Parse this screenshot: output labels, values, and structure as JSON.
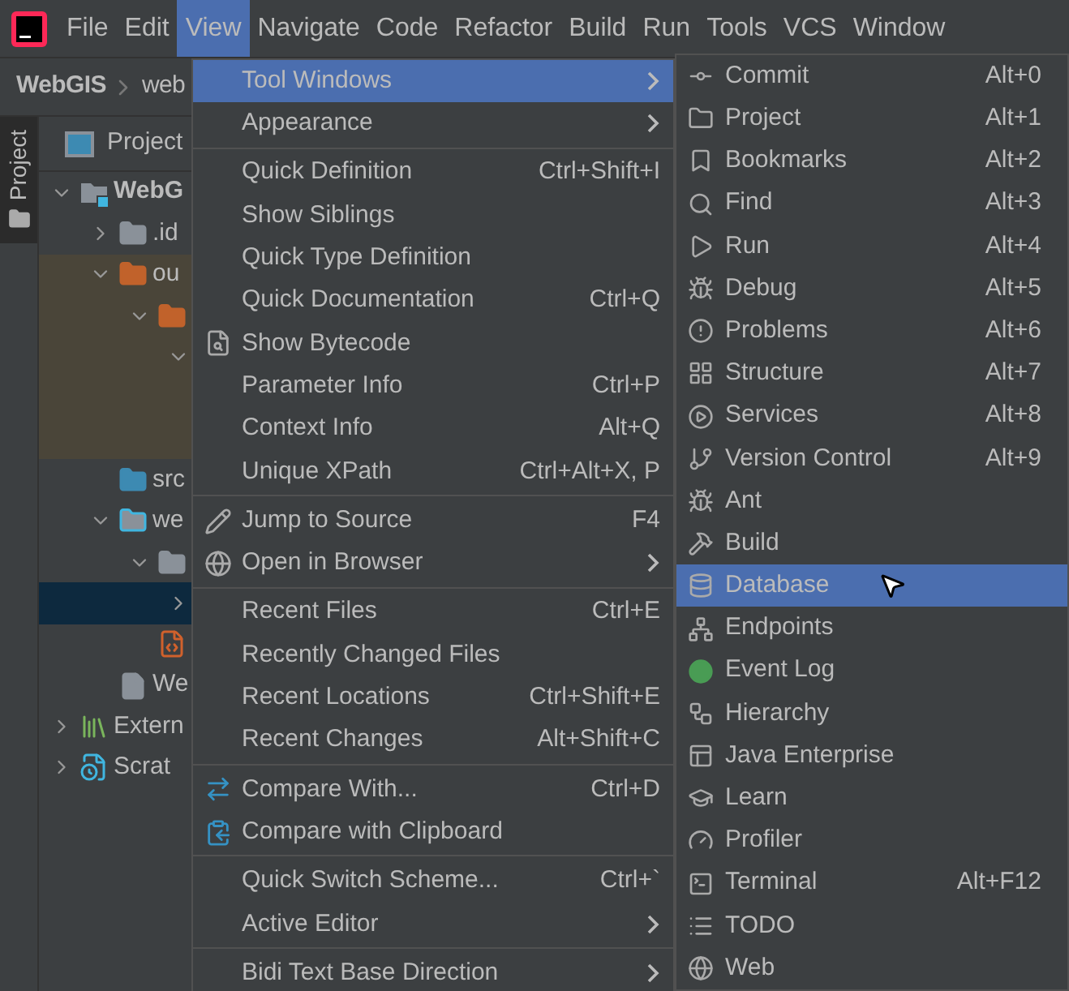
{
  "menubar": {
    "items": [
      {
        "label": "File",
        "selected": false
      },
      {
        "label": "Edit",
        "selected": false
      },
      {
        "label": "View",
        "selected": true
      },
      {
        "label": "Navigate",
        "selected": false
      },
      {
        "label": "Code",
        "selected": false
      },
      {
        "label": "Refactor",
        "selected": false
      },
      {
        "label": "Build",
        "selected": false
      },
      {
        "label": "Run",
        "selected": false
      },
      {
        "label": "Tools",
        "selected": false
      },
      {
        "label": "VCS",
        "selected": false
      },
      {
        "label": "Window",
        "selected": false
      }
    ]
  },
  "breadcrumb": [
    "WebGIS",
    "web"
  ],
  "side_tab": {
    "label": "Project",
    "selected": true
  },
  "project_panel": {
    "title": "Project",
    "tree": [
      {
        "kind": "module",
        "label": "WebG",
        "expanded": true,
        "selected": false,
        "children": [
          {
            "kind": "folder",
            "label": ".id",
            "expanded": false,
            "selected": false
          },
          {
            "kind": "excluded",
            "label": "ou",
            "expanded": true,
            "selected": false,
            "children": [
              {
                "kind": "excluded",
                "expanded": true,
                "selected": false,
                "children": [
                  {
                    "expanded": true,
                    "selected": false
                  }
                ]
              }
            ]
          },
          {
            "kind": "source",
            "label": "src",
            "selected": false
          },
          {
            "kind": "web",
            "label": "we",
            "expanded": true,
            "selected": false,
            "children": [
              {
                "kind": "folder",
                "expanded": true,
                "selected": false,
                "children": [
                  {
                    "expanded": false,
                    "selected": true
                  }
                ]
              },
              {
                "kind": "jsp",
                "selected": false
              }
            ]
          },
          {
            "kind": "file",
            "label": "We",
            "selected": false
          }
        ]
      },
      {
        "kind": "libraries",
        "label": "Extern",
        "expanded": false,
        "selected": false
      },
      {
        "kind": "scratches",
        "label": "Scrat",
        "expanded": false,
        "selected": false
      }
    ]
  },
  "view_menu": {
    "items": [
      {
        "kind": "item",
        "label": "Tool Windows",
        "submenu": true,
        "selected": true
      },
      {
        "kind": "item",
        "label": "Appearance",
        "submenu": true,
        "selected": false
      },
      {
        "kind": "separator"
      },
      {
        "kind": "item",
        "label": "Quick Definition",
        "shortcut": "Ctrl+Shift+I",
        "submenu": false,
        "selected": false
      },
      {
        "kind": "item",
        "label": "Show Siblings",
        "submenu": false,
        "selected": false
      },
      {
        "kind": "item",
        "label": "Quick Type Definition",
        "submenu": false,
        "selected": false
      },
      {
        "kind": "item",
        "label": "Quick Documentation",
        "shortcut": "Ctrl+Q",
        "submenu": false,
        "selected": false
      },
      {
        "kind": "item",
        "label": "Show Bytecode",
        "submenu": false,
        "selected": false
      },
      {
        "kind": "item",
        "label": "Parameter Info",
        "shortcut": "Ctrl+P",
        "submenu": false,
        "selected": false
      },
      {
        "kind": "item",
        "label": "Context Info",
        "shortcut": "Alt+Q",
        "submenu": false,
        "selected": false
      },
      {
        "kind": "item",
        "label": "Unique XPath",
        "shortcut": "Ctrl+Alt+X, P",
        "submenu": false,
        "selected": false
      },
      {
        "kind": "separator"
      },
      {
        "kind": "item",
        "label": "Jump to Source",
        "shortcut": "F4",
        "submenu": false,
        "selected": false
      },
      {
        "kind": "item",
        "label": "Open in Browser",
        "submenu": true,
        "selected": false
      },
      {
        "kind": "separator"
      },
      {
        "kind": "item",
        "label": "Recent Files",
        "shortcut": "Ctrl+E",
        "submenu": false,
        "selected": false
      },
      {
        "kind": "item",
        "label": "Recently Changed Files",
        "submenu": false,
        "selected": false
      },
      {
        "kind": "item",
        "label": "Recent Locations",
        "shortcut": "Ctrl+Shift+E",
        "submenu": false,
        "selected": false
      },
      {
        "kind": "item",
        "label": "Recent Changes",
        "shortcut": "Alt+Shift+C",
        "submenu": false,
        "selected": false
      },
      {
        "kind": "separator"
      },
      {
        "kind": "item",
        "label": "Compare With...",
        "shortcut": "Ctrl+D",
        "submenu": false,
        "selected": false
      },
      {
        "kind": "item",
        "label": "Compare with Clipboard",
        "submenu": false,
        "selected": false
      },
      {
        "kind": "separator"
      },
      {
        "kind": "item",
        "label": "Quick Switch Scheme...",
        "shortcut": "Ctrl+`",
        "submenu": false,
        "selected": false
      },
      {
        "kind": "item",
        "label": "Active Editor",
        "submenu": true,
        "selected": false
      },
      {
        "kind": "separator"
      },
      {
        "kind": "item",
        "label": "Bidi Text Base Direction",
        "submenu": true,
        "selected": false
      }
    ]
  },
  "tool_windows_menu": {
    "items": [
      {
        "label": "Commit",
        "shortcut": "Alt+0",
        "selected": false
      },
      {
        "label": "Project",
        "shortcut": "Alt+1",
        "selected": false
      },
      {
        "label": "Bookmarks",
        "shortcut": "Alt+2",
        "selected": false
      },
      {
        "label": "Find",
        "shortcut": "Alt+3",
        "selected": false
      },
      {
        "label": "Run",
        "shortcut": "Alt+4",
        "selected": false
      },
      {
        "label": "Debug",
        "shortcut": "Alt+5",
        "selected": false
      },
      {
        "label": "Problems",
        "shortcut": "Alt+6",
        "selected": false
      },
      {
        "label": "Structure",
        "shortcut": "Alt+7",
        "selected": false
      },
      {
        "label": "Services",
        "shortcut": "Alt+8",
        "selected": false
      },
      {
        "label": "Version Control",
        "shortcut": "Alt+9",
        "selected": false
      },
      {
        "label": "Ant",
        "selected": false
      },
      {
        "label": "Build",
        "selected": false
      },
      {
        "label": "Database",
        "selected": true
      },
      {
        "label": "Endpoints",
        "selected": false
      },
      {
        "label": "Event Log",
        "selected": false
      },
      {
        "label": "Hierarchy",
        "selected": false
      },
      {
        "label": "Java Enterprise",
        "selected": false
      },
      {
        "label": "Learn",
        "selected": false
      },
      {
        "label": "Profiler",
        "selected": false
      },
      {
        "label": "Terminal",
        "shortcut": "Alt+F12",
        "selected": false
      },
      {
        "label": "TODO",
        "selected": false
      },
      {
        "label": "Web",
        "selected": false
      }
    ]
  }
}
